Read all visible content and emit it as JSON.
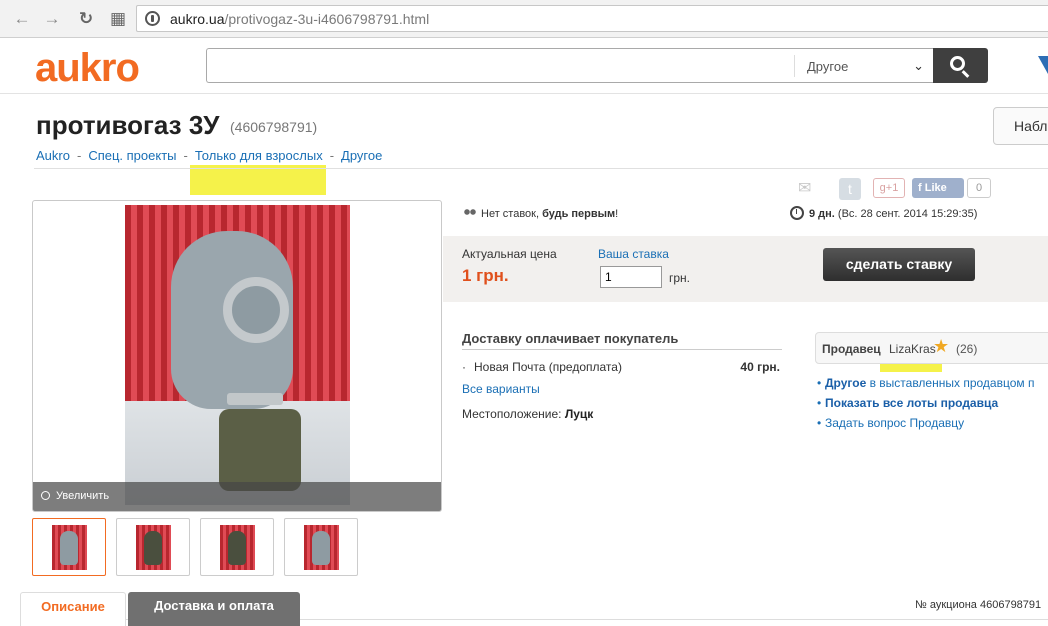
{
  "browser": {
    "url_domain": "aukro.ua",
    "url_path": "/protivogaz-3u-i4606798791.html",
    "back_icon": "←",
    "forward_icon": "→",
    "reload_icon": "↻",
    "apps_icon": "▦"
  },
  "header": {
    "logo": "aukro",
    "search_value": "",
    "category": "Другое",
    "brand_color": "#f26b22"
  },
  "item": {
    "title": "противогаз 3У",
    "id": "(4606798791)",
    "watch_label": "Набл"
  },
  "breadcrumb": [
    "Aukro",
    "Спец. проекты",
    "Только для взрослых",
    "Другое"
  ],
  "gallery": {
    "zoom_label": "Увеличить",
    "thumb_count": 4
  },
  "share": {
    "gplus_label": "g+1",
    "fb_label": "Like",
    "fb_count": "0"
  },
  "bid_status": {
    "text_plain": "Нет ставок, ",
    "text_bold": "будь первым",
    "text_end": "!"
  },
  "time_left": {
    "bold": "9 дн.",
    "rest": "(Вс. 28 сент. 2014 15:29:35)"
  },
  "bid_panel": {
    "current_label": "Актуальная цена",
    "current_price": "1 грн.",
    "your_bid_label": "Ваша ставка",
    "your_bid_value": "1",
    "unit": "грн.",
    "bid_button": "сделать ставку"
  },
  "delivery": {
    "title": "Доставку оплачивает покупатель",
    "option_name": "Новая Почта (предоплата)",
    "option_cost": "40 грн.",
    "more_link": "Все варианты",
    "location_label": "Местоположение:",
    "location_value": "Луцк"
  },
  "seller": {
    "label": "Продавец",
    "name": "LizaKras",
    "rating": "(26)",
    "link1_bold": "Другое",
    "link1_rest": " в выставленных продавцом п",
    "link2": "Показать все лоты продавца",
    "link3": "Задать вопрос Продавцу"
  },
  "tabs": {
    "description": "Описание",
    "delivery": "Доставка и оплата"
  },
  "auction_number": "№ аукциона 4606798791"
}
